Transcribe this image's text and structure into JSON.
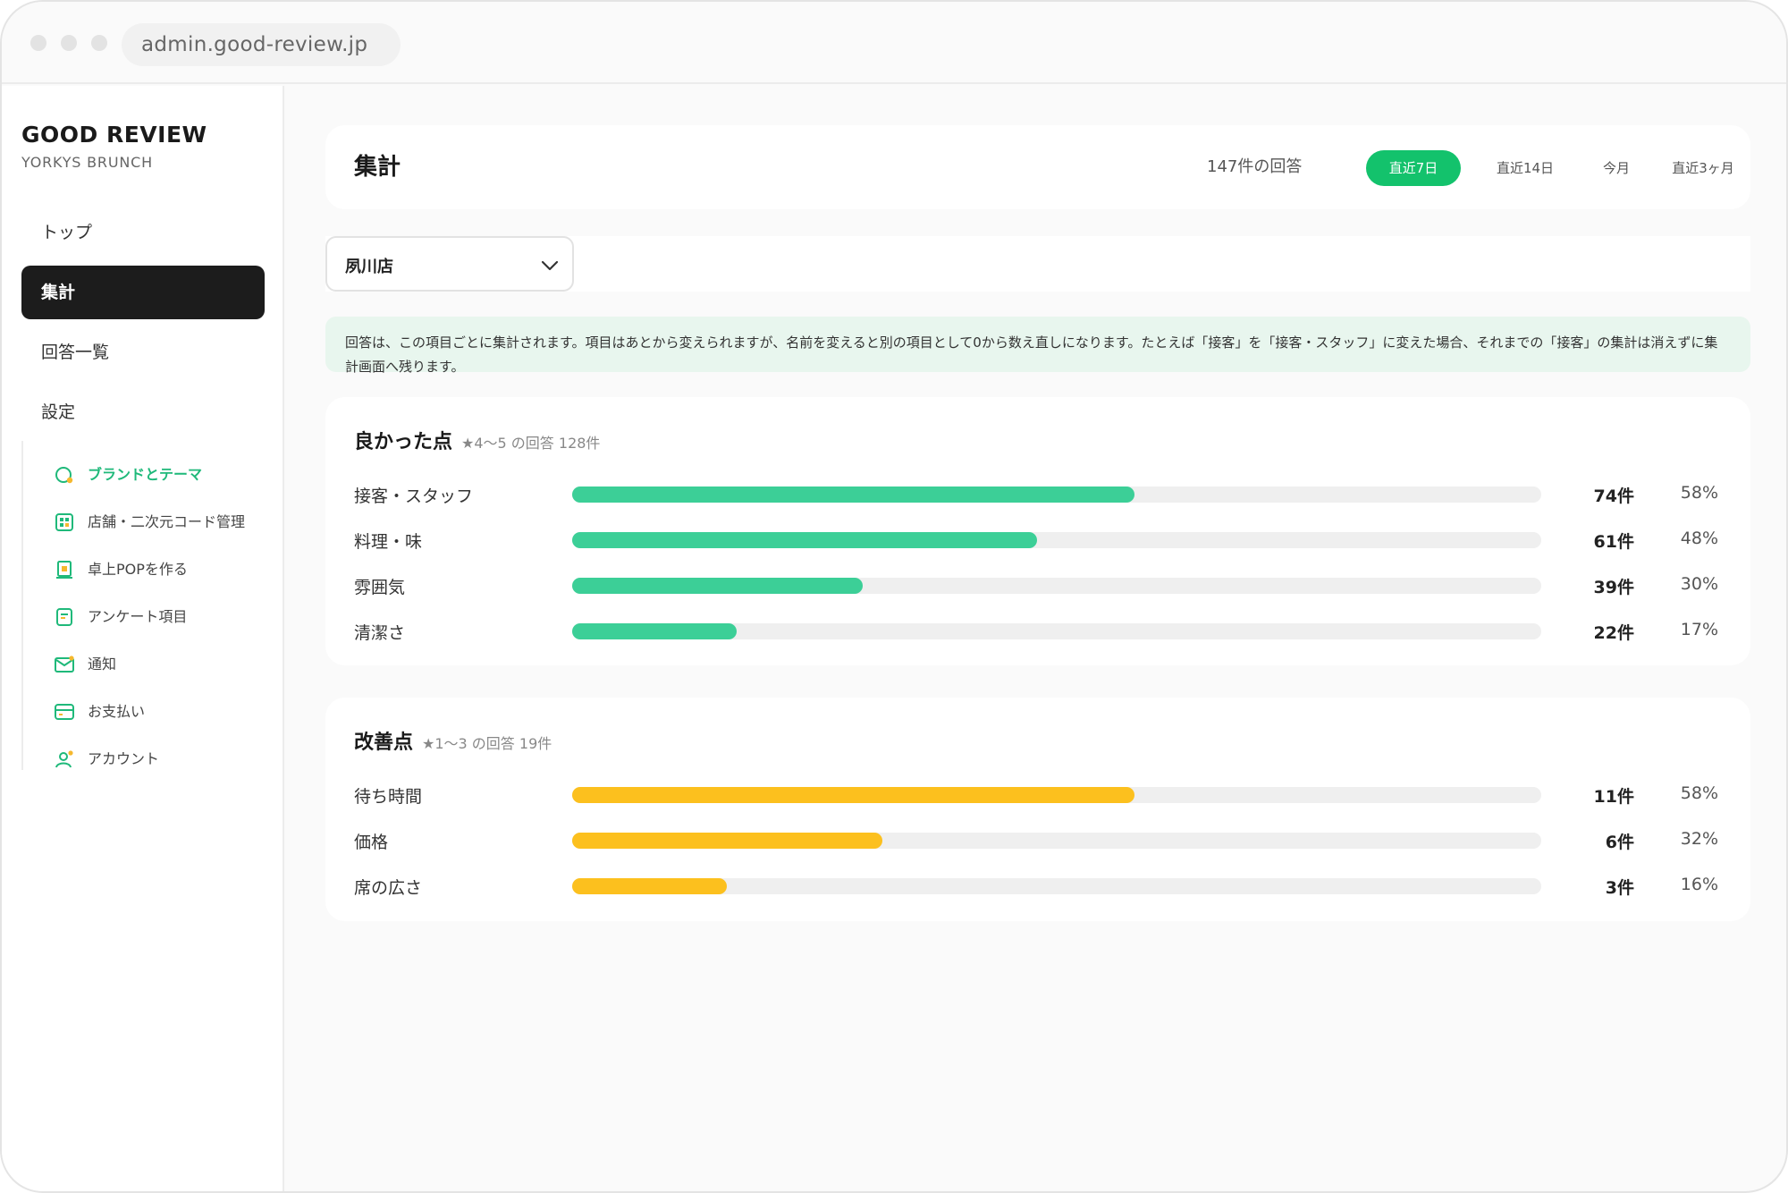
{
  "browser": {
    "url": "admin.good-review.jp"
  },
  "brand": {
    "title": "GOOD REVIEW",
    "subtitle": "YORKYS BRUNCH"
  },
  "nav": {
    "top": "トップ",
    "summary": "集計",
    "answers": "回答一覧",
    "settings": "設定",
    "sub_items": [
      {
        "label": "ブランドとテーマ",
        "icon": "palette-icon",
        "active": true
      },
      {
        "label": "店舗・二次元コード管理",
        "icon": "qr-code-icon",
        "active": false
      },
      {
        "label": "卓上POPを作る",
        "icon": "pop-stand-icon",
        "active": false
      },
      {
        "label": "アンケート項目",
        "icon": "survey-icon",
        "active": false
      },
      {
        "label": "通知",
        "icon": "mail-icon",
        "active": false
      },
      {
        "label": "お支払い",
        "icon": "credit-card-icon",
        "active": false
      },
      {
        "label": "アカウント",
        "icon": "account-icon",
        "active": false
      }
    ]
  },
  "header": {
    "title": "集計",
    "response_count": "147件の回答",
    "periods": [
      "直近7日",
      "直近14日",
      "今月",
      "直近3ヶ月"
    ],
    "active_period": "直近7日"
  },
  "store_select": {
    "value": "夙川店"
  },
  "notice": "回答は、この項目ごとに集計されます。項目はあとから変えられますが、名前を変えると別の項目として0から数え直しになります。たとえば「接客」を「接客・スタッフ」に変えた場合、それまでの「接客」の集計は消えずに集計画面へ残ります。",
  "good": {
    "title": "良かった点",
    "subtitle": "★4〜5 の回答 128件",
    "items": [
      {
        "name": "接客・スタッフ",
        "count": "74件",
        "pct": "58%",
        "value": 58
      },
      {
        "name": "料理・味",
        "count": "61件",
        "pct": "48%",
        "value": 48
      },
      {
        "name": "雰囲気",
        "count": "39件",
        "pct": "30%",
        "value": 30
      },
      {
        "name": "清潔さ",
        "count": "22件",
        "pct": "17%",
        "value": 17
      }
    ]
  },
  "bad": {
    "title": "改善点",
    "subtitle": "★1〜3 の回答 19件",
    "items": [
      {
        "name": "待ち時間",
        "count": "11件",
        "pct": "58%",
        "value": 58
      },
      {
        "name": "価格",
        "count": "6件",
        "pct": "32%",
        "value": 32
      },
      {
        "name": "席の広さ",
        "count": "3件",
        "pct": "16%",
        "value": 16
      }
    ]
  },
  "colors": {
    "accent": "#13c26c",
    "good_bar": "#3ccf97",
    "bad_bar": "#fcc01e",
    "notice_bg": "#e8f6ee"
  }
}
